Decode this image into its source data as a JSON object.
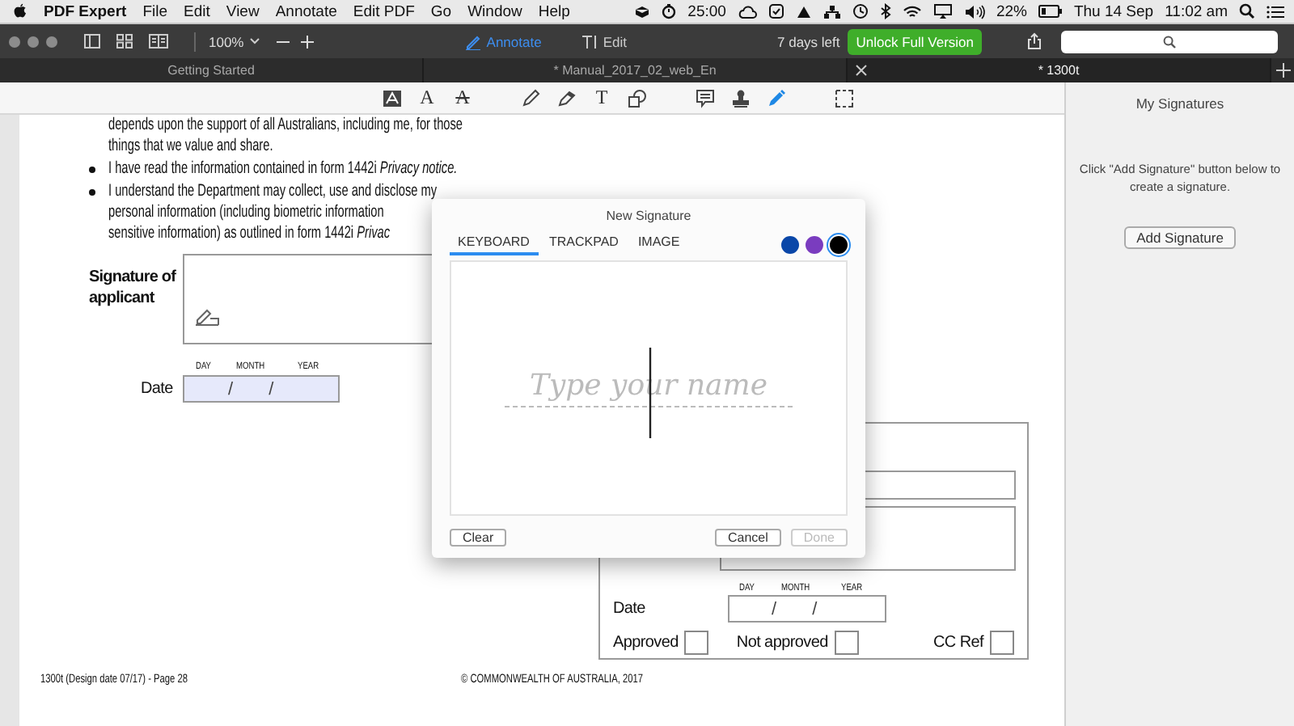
{
  "menu_bar": {
    "app_name": "PDF Expert",
    "menus": [
      "File",
      "Edit",
      "View",
      "Annotate",
      "Edit PDF",
      "Go",
      "Window",
      "Help"
    ],
    "timer": "25:00",
    "battery": "22%",
    "date": "Thu 14 Sep",
    "time": "11:02 am"
  },
  "toolbar": {
    "zoom": "100%",
    "modes": [
      {
        "kind": "annotate",
        "label": "Annotate",
        "selected": true
      },
      {
        "kind": "edit",
        "label": "Edit",
        "selected": false
      }
    ],
    "trial": "7 days left",
    "unlock_button": "Unlock Full Version"
  },
  "tabs": [
    {
      "label": "Getting Started",
      "selected": false
    },
    {
      "label": "* Manual_2017_02_web_En",
      "selected": false
    },
    {
      "label": "* 1300t",
      "selected": true
    }
  ],
  "annotation_tools": [
    {
      "kind": "boxed-text",
      "selected": false
    },
    {
      "kind": "glyph",
      "label": "A",
      "selected": false
    },
    {
      "kind": "strike",
      "label": "A",
      "selected": false
    },
    {
      "kind": "pencil",
      "selected": false
    },
    {
      "kind": "eraser",
      "selected": false
    },
    {
      "kind": "glyph",
      "label": "T",
      "selected": false
    },
    {
      "kind": "shapes",
      "selected": false
    },
    {
      "kind": "comment",
      "selected": false
    },
    {
      "kind": "stamp",
      "selected": false
    },
    {
      "kind": "pen",
      "selected": true
    },
    {
      "kind": "selection",
      "selected": false
    }
  ],
  "document": {
    "paragraphs": [
      {
        "bullet": false,
        "lines": [
          "depends upon the support of all Australians, including me, for those",
          "things that we value and share."
        ]
      },
      {
        "bullet": true,
        "lines": [
          "I have read the information contained in form 1442i *Privacy notice.*"
        ]
      },
      {
        "bullet": true,
        "lines": [
          "I understand the Department may collect, use and disclose my",
          "personal information (including biometric information",
          "sensitive information) as outlined in form 1442i *Privac*"
        ]
      }
    ],
    "signature_label": "Signature of applicant",
    "date_label": "Date",
    "date_parts": [
      "DAY",
      "MONTH",
      "YEAR"
    ],
    "date_separators": [
      "/",
      "/"
    ],
    "office": {
      "date_parts": [
        "DAY",
        "MONTH",
        "YEAR"
      ],
      "date_label": "Date",
      "date_separators": [
        "/",
        "/"
      ],
      "checkboxes": [
        {
          "label": "Approved",
          "checked": false
        },
        {
          "label": "Not approved",
          "checked": false
        },
        {
          "label": "CC Ref",
          "checked": false
        }
      ]
    },
    "footer": {
      "left": "1300t (Design date 07/17) - Page 28",
      "center": "© COMMONWEALTH OF AUSTRALIA, 2017"
    }
  },
  "sidebar": {
    "title": "My Signatures",
    "hint": "Click \"Add Signature\" button below to create a signature.",
    "button": "Add Signature"
  },
  "dialog": {
    "title": "New Signature",
    "tabs": [
      {
        "label": "KEYBOARD",
        "selected": true
      },
      {
        "label": "TRACKPAD",
        "selected": false
      },
      {
        "label": "IMAGE",
        "selected": false
      }
    ],
    "colors": [
      {
        "color": "#0a47a8",
        "selected": false
      },
      {
        "color": "#7a3cbf",
        "selected": false
      },
      {
        "color": "#000000",
        "selected": true
      }
    ],
    "placeholder": "Type your name",
    "buttons": [
      {
        "label": "Clear",
        "disabled": false
      },
      {
        "label": "Cancel",
        "disabled": false
      },
      {
        "label": "Done",
        "disabled": true
      }
    ]
  }
}
